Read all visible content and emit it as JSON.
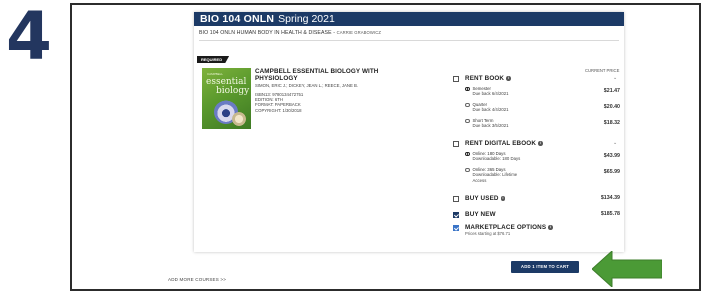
{
  "step_number": "4",
  "course": {
    "code": "BIO 104 ONLN",
    "term": "Spring 2021",
    "full_title": "BIO 104 ONLN HUMAN BODY IN HEALTH & DISEASE",
    "instructor_separator": " - ",
    "instructor": "CARRIE GRABOWICZ"
  },
  "required_label": "REQUIRED",
  "current_price_label": "CURRENT PRICE",
  "book": {
    "cover": {
      "small_text": "CAMPBELL",
      "title_line1": "essential",
      "title_line2": "biology"
    },
    "title_line1": "CAMPBELL ESSENTIAL BIOLOGY WITH",
    "title_line2": "PHYSIOLOGY",
    "authors": "SIMON, ERIC J.; DICKEY, JEAN L.; REECE, JANE B.",
    "isbn": "ISBN13: 9780134472751",
    "edition": "EDITION: 6TH",
    "format": "FORMAT: PAPERBACK",
    "copyright": "COPYRIGHT: 1/30/2018"
  },
  "options": {
    "rent_book": {
      "label": "RENT BOOK",
      "checked": false,
      "terms": [
        {
          "name": "Semester",
          "due": "Due back 6/4/2021",
          "price": "$21.47",
          "selected": true
        },
        {
          "name": "Quarter",
          "due": "Due back 4/4/2021",
          "price": "$20.40",
          "selected": false
        },
        {
          "name": "Short Term",
          "due": "Due back 3/5/2021",
          "price": "$18.32",
          "selected": false
        }
      ]
    },
    "rent_digital": {
      "label": "RENT DIGITAL EBOOK",
      "checked": false,
      "terms": [
        {
          "name": "Online: 180 Days",
          "detail1": "Downloadable: 180 Days",
          "detail2": "",
          "price": "$43.99",
          "selected": true
        },
        {
          "name": "Online: 365 Days",
          "detail1": "Downloadable: Lifetime",
          "detail2": "Access",
          "price": "$65.99",
          "selected": false
        }
      ]
    },
    "buy_used": {
      "label": "BUY USED",
      "price": "$134.39",
      "checked": false
    },
    "buy_new": {
      "label": "BUY NEW",
      "price": "$185.78",
      "checked": true
    },
    "marketplace": {
      "label": "MARKETPLACE OPTIONS",
      "sub": "Prices starting at $76.71",
      "checked": true
    }
  },
  "add_to_cart_label": "ADD 1 ITEM TO CART",
  "add_more_courses_label": "ADD MORE COURSES >>",
  "colors": {
    "navy": "#1c3a66",
    "step_number": "#23365f",
    "arrow_green": "#4b9a36",
    "marketplace_blue": "#3a74c7"
  },
  "icons": {
    "info": "info-icon",
    "chevron": "chevron-down-icon",
    "arrow": "arrow-left-icon"
  }
}
